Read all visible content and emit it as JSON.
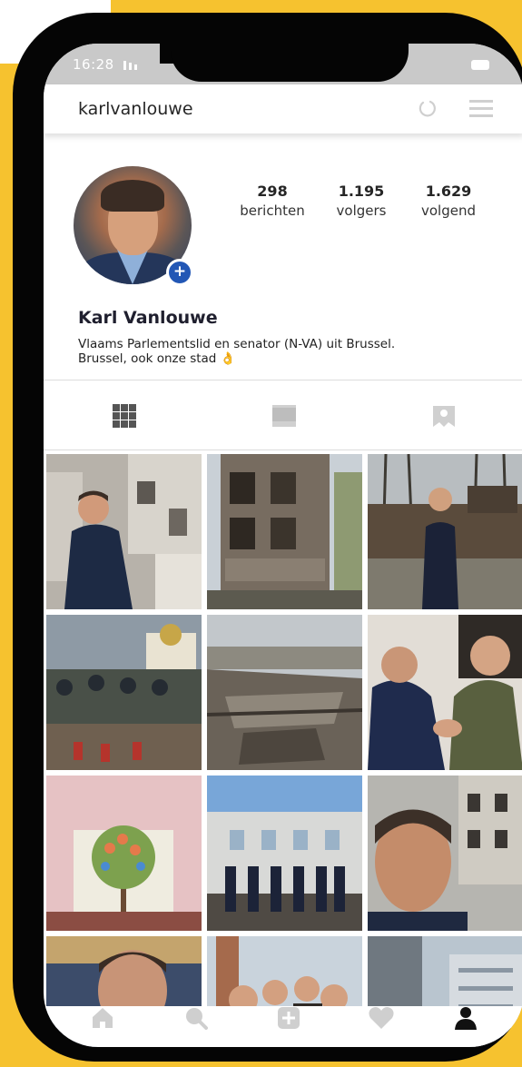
{
  "status": {
    "time": "16:28"
  },
  "header": {
    "username": "karlvanlouwe"
  },
  "profile": {
    "name": "Karl Vanlouwe",
    "bio_line1": "Vlaams Parlementslid en senator (N-VA) uit Brussel.",
    "bio_line2": "Brussel, ook onze stad 👌",
    "stats": [
      {
        "value": "298",
        "label": "berichten"
      },
      {
        "value": "1.195",
        "label": "volgers"
      },
      {
        "value": "1.629",
        "label": "volgend"
      }
    ]
  },
  "tabs": [
    {
      "icon": "grid-icon"
    },
    {
      "icon": "feed-icon"
    },
    {
      "icon": "tagged-icon"
    }
  ],
  "bottom_nav": [
    {
      "icon": "home-icon"
    },
    {
      "icon": "search-icon"
    },
    {
      "icon": "add-post-icon"
    },
    {
      "icon": "heart-icon"
    },
    {
      "icon": "profile-icon"
    }
  ],
  "photos": [
    {
      "subject": "man in puffer jacket before damaged building"
    },
    {
      "subject": "bombed apartment building"
    },
    {
      "subject": "man beside destroyed tank"
    },
    {
      "subject": "group laying flowers near church"
    },
    {
      "subject": "collapsed bridge"
    },
    {
      "subject": "handshake between two men"
    },
    {
      "subject": "tree mural on wall"
    },
    {
      "subject": "group photo outside building"
    },
    {
      "subject": "selfie before ruined building"
    },
    {
      "subject": "man speaking in parliament"
    },
    {
      "subject": "group selfie outdoors"
    },
    {
      "subject": "city buildings"
    }
  ],
  "colors": {
    "accent": "#2257b5",
    "background": "#f6c22f"
  }
}
